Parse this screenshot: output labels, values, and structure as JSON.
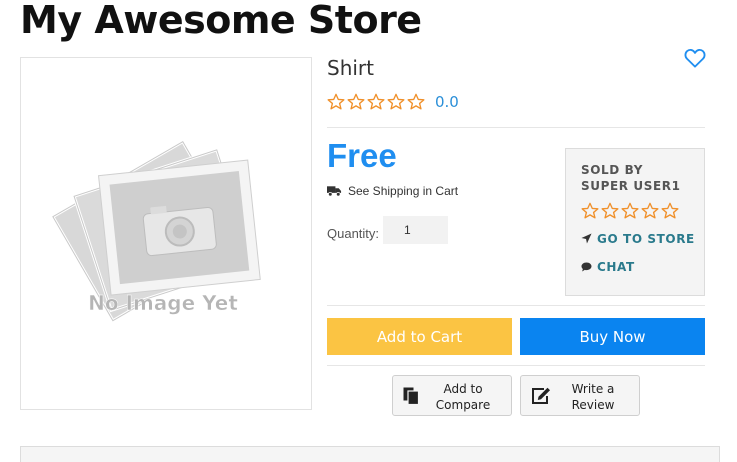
{
  "store": {
    "title": "My Awesome Store"
  },
  "product": {
    "name": "Shirt",
    "image_alt_text": "No Image Yet",
    "rating": {
      "value": "0.0",
      "stars_filled": 0,
      "stars_total": 5
    },
    "price": "Free",
    "shipping_link": "See Shipping in Cart",
    "quantity": {
      "label": "Quantity:",
      "value": "1"
    }
  },
  "seller": {
    "label_line1": "SOLD BY",
    "label_line2": "SUPER USER1",
    "stars_filled": 0,
    "stars_total": 5,
    "go_to_store": "GO TO STORE",
    "chat": "CHAT"
  },
  "actions": {
    "add_to_cart": "Add to Cart",
    "buy_now": "Buy Now",
    "add_to_compare": "Add to\nCompare",
    "write_review": "Write a\nReview"
  },
  "icons": {
    "wishlist": "heart-outline-icon",
    "star": "star-outline-icon",
    "shipping": "truck-icon",
    "go_to_store": "location-arrow-icon",
    "chat": "chat-bubble-icon",
    "compare": "copy-files-icon",
    "review": "edit-icon"
  },
  "colors": {
    "price": "#1f8ef0",
    "rating_value": "#2b8fd8",
    "star": "#f0902a",
    "add_to_cart": "#fbc443",
    "buy_now": "#0a84f0",
    "seller_link": "#2a7a8c",
    "wishlist": "#1f8ef0"
  }
}
